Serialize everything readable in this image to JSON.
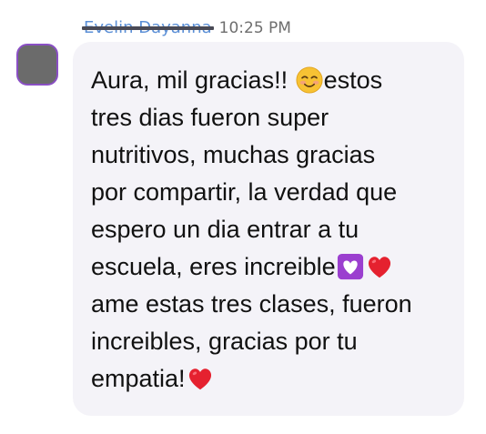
{
  "message": {
    "sender": "Evelin Dayanna",
    "timestamp": "10:25 PM",
    "lines": [
      [
        "Aura, mil gracias!! ",
        "emoji:smiling-face-icon",
        "estos"
      ],
      [
        "tres dias fueron super"
      ],
      [
        "nutritivos, muchas gracias"
      ],
      [
        "por compartir, la verdad que"
      ],
      [
        "espero un dia entrar a tu"
      ],
      [
        "escuela, eres increible",
        "emoji:heart-decoration-icon",
        "emoji:red-heart-icon"
      ],
      [
        "ame estas tres clases, fueron"
      ],
      [
        "increibles, gracias por tu"
      ],
      [
        "empatia!",
        "emoji:red-heart-icon"
      ]
    ]
  },
  "colors": {
    "sender_name": "#5b8fd6",
    "bubble_bg": "#f4f3f8",
    "avatar_border": "#8a4fc4",
    "avatar_fill": "#6b6b6b"
  }
}
